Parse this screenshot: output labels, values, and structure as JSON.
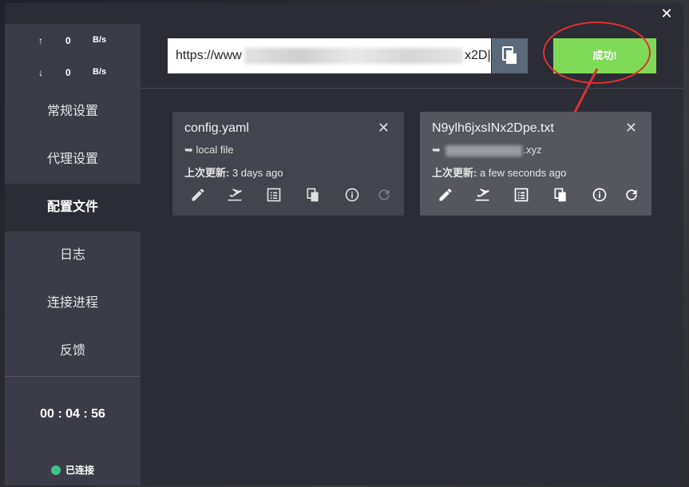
{
  "window": {
    "close_label": "✕"
  },
  "traffic": {
    "upload": {
      "arrow": "↑",
      "value": "0",
      "unit": "B/s"
    },
    "download": {
      "arrow": "↓",
      "value": "0",
      "unit": "B/s"
    }
  },
  "nav": [
    {
      "label": "常规设置"
    },
    {
      "label": "代理设置"
    },
    {
      "label": "配置文件",
      "active": true
    },
    {
      "label": "日志"
    },
    {
      "label": "连接进程"
    },
    {
      "label": "反馈"
    }
  ],
  "timer": "00 : 04 : 56",
  "status": {
    "label": "已连接",
    "color": "#3ec28a"
  },
  "url_bar": {
    "value": "https://www",
    "value_end": "x2D|"
  },
  "success_button": {
    "label": "成功!",
    "color": "#7ed957"
  },
  "annotation": {
    "color": "#e03030"
  },
  "profiles": [
    {
      "name": "config.yaml",
      "source_prefix": "➥",
      "source": "local file",
      "updated_label": "上次更新:",
      "updated_value": "3 days ago",
      "close": "✕"
    },
    {
      "name": "N9ylh6jxsINx2Dpe.txt",
      "source_prefix": "➥",
      "source": ".xyz",
      "updated_label": "上次更新:",
      "updated_value": "a few seconds ago",
      "close": "✕"
    }
  ],
  "card_icons": [
    "edit-icon",
    "update-icon",
    "log-icon",
    "copy-icon",
    "info-icon",
    "refresh-icon"
  ]
}
